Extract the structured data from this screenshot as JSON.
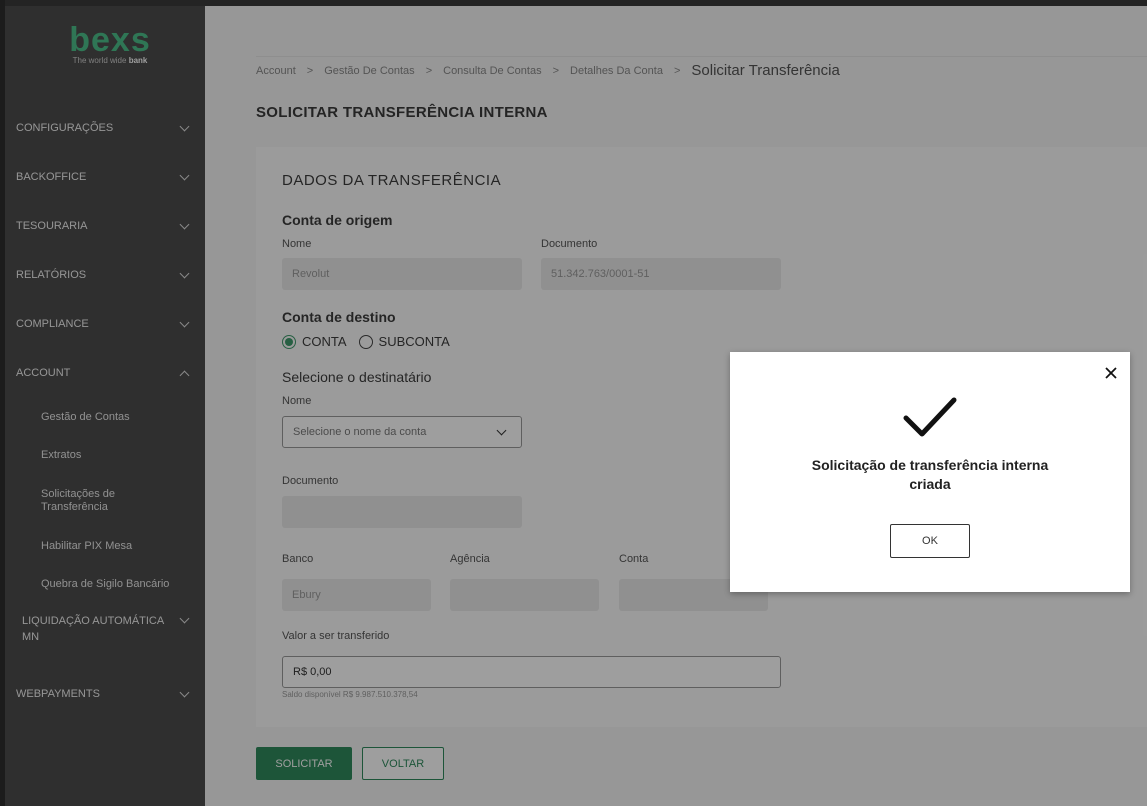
{
  "brand": {
    "name": "bexs",
    "tagline_prefix": "The world wide",
    "tagline_bold": "bank",
    "accent": "#4dbf8a"
  },
  "sidebar": {
    "items": [
      {
        "label": "CONFIGURAÇÕES"
      },
      {
        "label": "BACKOFFICE"
      },
      {
        "label": "TESOURARIA"
      },
      {
        "label": "RELATÓRIOS"
      },
      {
        "label": "COMPLIANCE"
      },
      {
        "label": "ACCOUNT",
        "expanded": true
      },
      {
        "label": "LIQUIDAÇÃO AUTOMÁTICA MN"
      },
      {
        "label": "WEBPAYMENTS"
      }
    ],
    "account_sub": [
      {
        "label": "Gestão de Contas"
      },
      {
        "label": "Extratos"
      },
      {
        "label": "Solicitações de Transferência"
      },
      {
        "label": "Habilitar PIX Mesa"
      },
      {
        "label": "Quebra de Sigilo Bancário"
      }
    ]
  },
  "breadcrumb": {
    "items": [
      "Account",
      "Gestão De Contas",
      "Consulta De Contas",
      "Detalhes Da Conta"
    ],
    "current": "Solicitar Transferência",
    "separator": ">"
  },
  "page": {
    "title": "SOLICITAR TRANSFERÊNCIA INTERNA"
  },
  "form": {
    "section_title": "DADOS DA TRANSFERÊNCIA",
    "origin": {
      "title": "Conta de origem",
      "name_label": "Nome",
      "name_value": "Revolut",
      "doc_label": "Documento",
      "doc_value": "51.342.763/0001-51"
    },
    "destination": {
      "title": "Conta de destino",
      "radio_conta": "CONTA",
      "radio_subconta": "SUBCONTA",
      "selected": "CONTA",
      "select_title": "Selecione o destinatário",
      "name_label": "Nome",
      "name_placeholder": "Selecione o nome da conta",
      "doc_label": "Documento",
      "doc_value": "",
      "bank_label": "Banco",
      "bank_value": "Ebury",
      "agency_label": "Agência",
      "agency_value": "",
      "account_label": "Conta",
      "account_value": ""
    },
    "amount": {
      "label": "Valor a ser transferido",
      "value": "R$ 0,00",
      "balance_hint": "Saldo disponível R$ 9.987.510.378,54"
    },
    "submit_label": "SOLICITAR",
    "back_label": "VOLTAR",
    "primary_color": "#2f8a5d"
  },
  "modal": {
    "message": "Solicitação de transferência interna criada",
    "ok_label": "OK",
    "close_icon": "close-icon",
    "status_icon": "checkmark-icon"
  }
}
